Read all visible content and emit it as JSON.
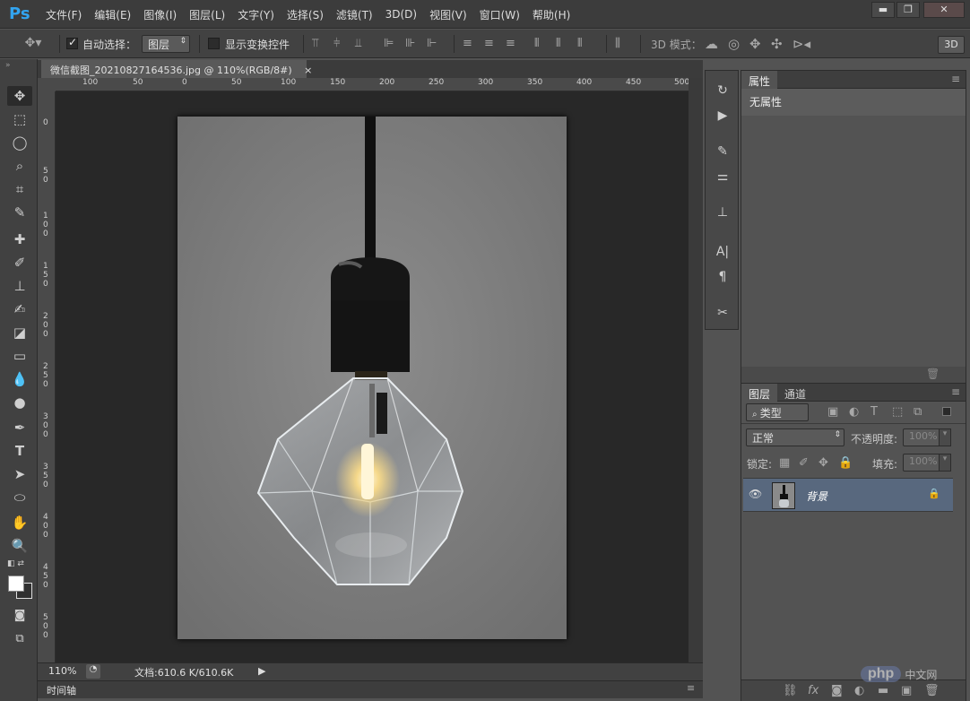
{
  "app": {
    "logo": "Ps"
  },
  "menu": [
    "文件(F)",
    "编辑(E)",
    "图像(I)",
    "图层(L)",
    "文字(Y)",
    "选择(S)",
    "滤镜(T)",
    "3D(D)",
    "视图(V)",
    "窗口(W)",
    "帮助(H)"
  ],
  "window_controls": {
    "minimize": "▬",
    "restore": "❐",
    "close": "✕"
  },
  "options": {
    "auto_select_label": "自动选择：",
    "auto_select_value": "图层",
    "show_transform_label": "显示变换控件",
    "mode_3d_label": "3D 模式：",
    "btn_3d": "3D"
  },
  "document": {
    "tab_title": "微信截图_20210827164536.jpg @ 110%(RGB/8#)",
    "tab_close": "×"
  },
  "ruler_top": [
    "100",
    "50",
    "0",
    "50",
    "100",
    "150",
    "200",
    "250",
    "300",
    "350",
    "400",
    "450",
    "500"
  ],
  "ruler_left": [
    "0",
    "5\n0",
    "1\n0\n0",
    "1\n5\n0",
    "2\n0\n0",
    "2\n5\n0",
    "3\n0\n0",
    "3\n5\n0",
    "4\n0\n0",
    "4\n5\n0",
    "5\n0\n0"
  ],
  "status": {
    "zoom": "110%",
    "doc_info": "文档:610.6 K/610.6K"
  },
  "timeline": {
    "label": "时间轴"
  },
  "properties_panel": {
    "tab": "属性",
    "content": "无属性"
  },
  "layers_panel": {
    "tabs": [
      "图层",
      "通道"
    ],
    "filter_kind": "类型",
    "blend_mode": "正常",
    "opacity_label": "不透明度:",
    "opacity_value": "100%",
    "lock_label": "锁定:",
    "fill_label": "填充:",
    "fill_value": "100%",
    "layers": [
      {
        "name": "背景",
        "visible": true,
        "locked": true
      }
    ]
  },
  "watermark": {
    "text": "php",
    "sub": "中文网"
  },
  "colors": {
    "accent": "#32a4f0",
    "layer_selected": "#58687e",
    "canvas_bg": "#282828"
  }
}
